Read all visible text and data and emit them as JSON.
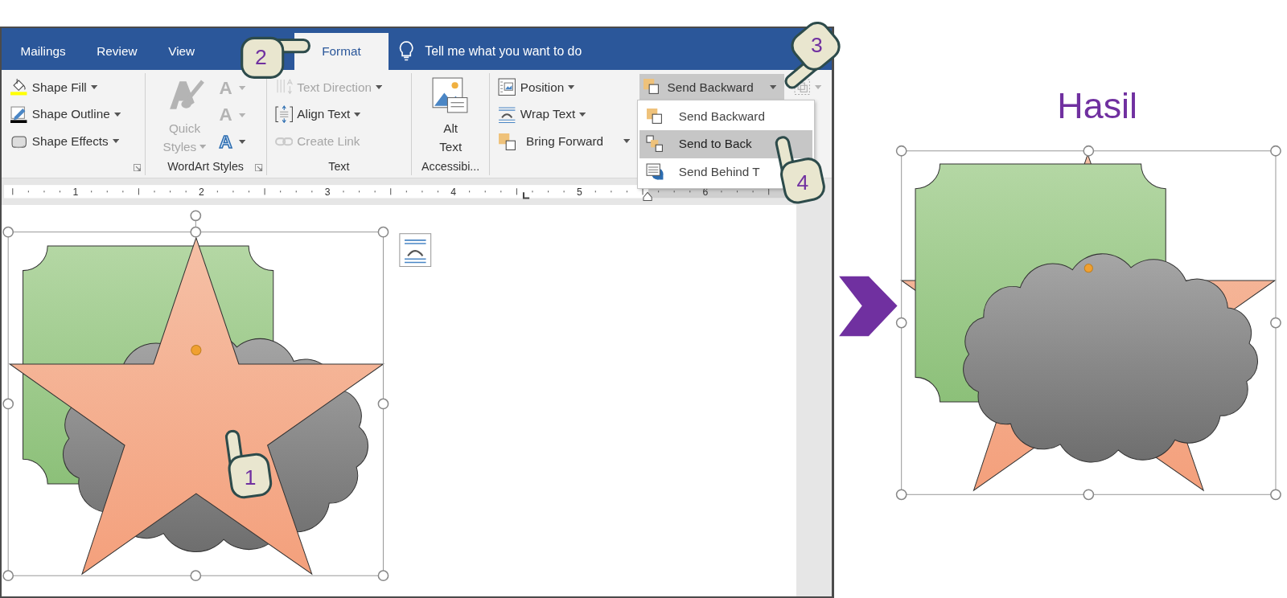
{
  "tabs": [
    {
      "label": "Mailings",
      "selected": false
    },
    {
      "label": "Review",
      "selected": false
    },
    {
      "label": "View",
      "selected": false
    },
    {
      "label": "Format",
      "selected": true
    }
  ],
  "tell_me": {
    "text": "Tell me what you want to do"
  },
  "ribbon": {
    "groups": [
      {
        "launcher": true,
        "items": [
          {
            "label": "Shape Fill",
            "disabled": false,
            "dropdown": true
          },
          {
            "label": "Shape Outline",
            "disabled": false,
            "dropdown": true
          },
          {
            "label": "Shape Effects",
            "disabled": false,
            "dropdown": true
          }
        ]
      },
      {
        "label": "WordArt Styles",
        "launcher": true,
        "items": [
          {
            "label": "Quick Styles",
            "disabled": true,
            "dropdown": true
          }
        ],
        "glyphs": [
          {
            "glyph": "A",
            "disabled": true
          },
          {
            "glyph": "A",
            "disabled": true
          },
          {
            "glyph": "A",
            "disabled": false
          }
        ]
      },
      {
        "label": "Text",
        "launcher": false,
        "items": [
          {
            "label": "Text Direction",
            "disabled": true,
            "dropdown": true
          },
          {
            "label": "Align Text",
            "disabled": false,
            "dropdown": true
          },
          {
            "label": "Create Link",
            "disabled": true,
            "dropdown": false
          }
        ]
      },
      {
        "label": "Accessibi...",
        "launcher": false,
        "items": [
          {
            "label": "Alt Text",
            "disabled": false,
            "dropdown": false
          }
        ]
      },
      {
        "launcher": false,
        "items": [
          {
            "label": "Position",
            "disabled": false,
            "dropdown": true,
            "expanded": false
          },
          {
            "label": "Wrap Text",
            "disabled": false,
            "dropdown": true,
            "expanded": false
          },
          {
            "label": "Bring Forward",
            "disabled": false,
            "dropdown": true,
            "expanded": false
          },
          {
            "label": "Send Backward",
            "disabled": false,
            "dropdown": true,
            "expanded": true
          }
        ]
      }
    ]
  },
  "menu": [
    {
      "label": "Send Backward",
      "selected": false
    },
    {
      "label": "Send to Back",
      "selected": true
    },
    {
      "label": "Send Behind T",
      "selected": false
    }
  ],
  "ruler": {
    "numbers": [
      "1",
      "2",
      "3",
      "4",
      "5",
      "6"
    ]
  },
  "callouts": [
    {
      "number": "1"
    },
    {
      "number": "2"
    },
    {
      "number": "3"
    },
    {
      "number": "4"
    }
  ],
  "result": {
    "title": "Hasil"
  }
}
